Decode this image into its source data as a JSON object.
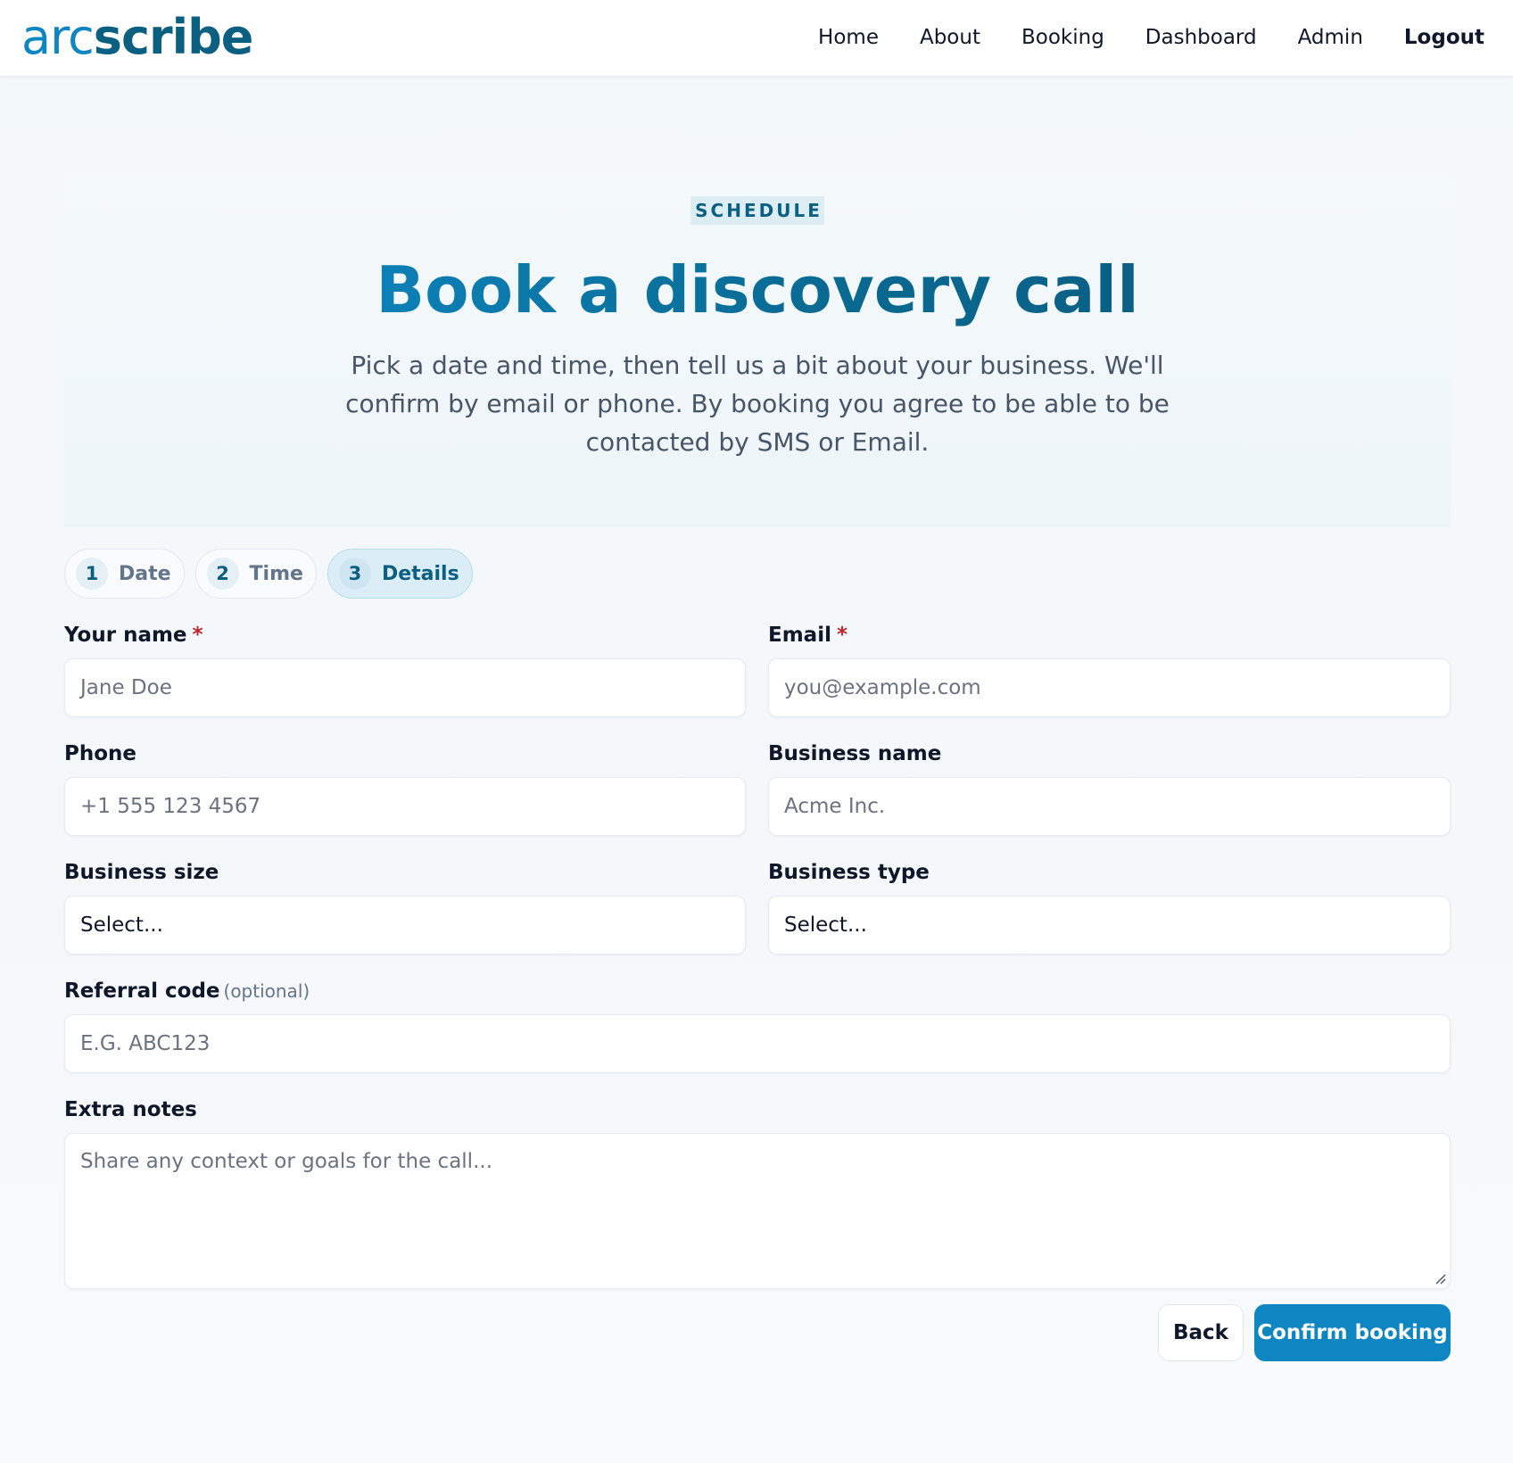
{
  "brand": {
    "part1": "arc",
    "part2": "scribe"
  },
  "nav": {
    "home": "Home",
    "about": "About",
    "booking": "Booking",
    "dashboard": "Dashboard",
    "admin": "Admin",
    "logout": "Logout"
  },
  "hero": {
    "eyebrow": "SCHEDULE",
    "title": "Book a discovery call",
    "description": "Pick a date and time, then tell us a bit about your business. We'll confirm by email or phone. By booking you agree to be able to be contacted by SMS or Email."
  },
  "steps": [
    {
      "number": "1",
      "label": "Date"
    },
    {
      "number": "2",
      "label": "Time"
    },
    {
      "number": "3",
      "label": "Details",
      "active": true
    }
  ],
  "form": {
    "name": {
      "label": "Your name",
      "required_mark": "*",
      "placeholder": "Jane Doe"
    },
    "email": {
      "label": "Email",
      "required_mark": "*",
      "placeholder": "you@example.com"
    },
    "phone": {
      "label": "Phone",
      "placeholder": "+1 555 123 4567"
    },
    "business_name": {
      "label": "Business name",
      "placeholder": "Acme Inc."
    },
    "business_size": {
      "label": "Business size",
      "value": "Select..."
    },
    "business_type": {
      "label": "Business type",
      "value": "Select..."
    },
    "referral": {
      "label": "Referral code",
      "optional": "(optional)",
      "placeholder": "E.G. ABC123"
    },
    "notes": {
      "label": "Extra notes",
      "placeholder": "Share any context or goals for the call..."
    }
  },
  "actions": {
    "back": "Back",
    "confirm": "Confirm booking"
  },
  "colors": {
    "accent": "#0e86c2",
    "brand_dark": "#0b5f80",
    "required": "#c0262d"
  }
}
